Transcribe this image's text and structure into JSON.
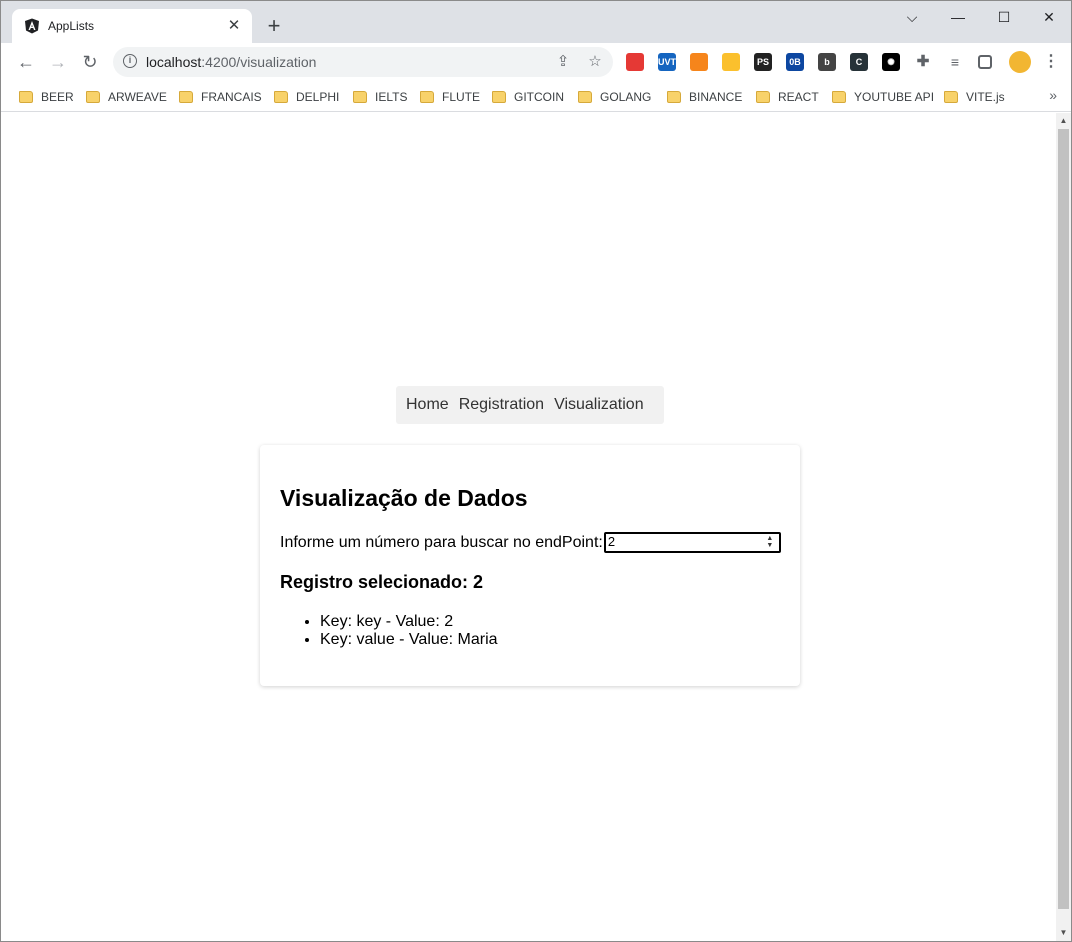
{
  "browser": {
    "tab_title": "AppLists",
    "tab_close": "✕",
    "new_tab": "+",
    "window_controls": {
      "dropdown": "⌵",
      "minimize": "—",
      "maximize": "☐",
      "close": "✕"
    },
    "url_host": "localhost",
    "url_path": ":4200/visualization",
    "bookmarks": [
      "BEER",
      "ARWEAVE",
      "FRANCAIS",
      "DELPHI",
      "IELTS",
      "FLUTE",
      "GITCOIN",
      "GOLANG",
      "BINANCE",
      "REACT",
      "YOUTUBE API",
      "VITE.js"
    ],
    "bookmarks_more": "»",
    "extensions": [
      {
        "name": "shield-extension-icon",
        "label": "",
        "color": "#e53935"
      },
      {
        "name": "uvt-extension-icon",
        "label": "UVT",
        "color": "#1565c0"
      },
      {
        "name": "metamask-extension-icon",
        "label": "",
        "color": "#f6851b"
      },
      {
        "name": "stats-extension-icon",
        "label": "",
        "color": "#fbc02d"
      },
      {
        "name": "ps-extension-icon",
        "label": "PS",
        "color": "#222222"
      },
      {
        "name": "ob-extension-icon",
        "label": "0B",
        "color": "#0d47a1"
      },
      {
        "name": "b-extension-icon",
        "label": "b",
        "color": "#444444"
      },
      {
        "name": "c-extension-icon",
        "label": "C",
        "color": "#263238"
      },
      {
        "name": "gpt-extension-icon",
        "label": "✺",
        "color": "#000000"
      }
    ]
  },
  "page": {
    "nav": [
      "Home",
      "Registration",
      "Visualization"
    ],
    "title": "Visualização de Dados",
    "query_label": "Informe um número para buscar no endPoint:",
    "query_value": "2",
    "selected_heading": "Registro selecionado: 2",
    "items": [
      "Key: key - Value: 2",
      "Key: value - Value: Maria"
    ]
  },
  "colors": {
    "tabstrip": "#dee1e6",
    "navbar_bg": "#f1f1f1",
    "folder": "#f8d26a"
  }
}
